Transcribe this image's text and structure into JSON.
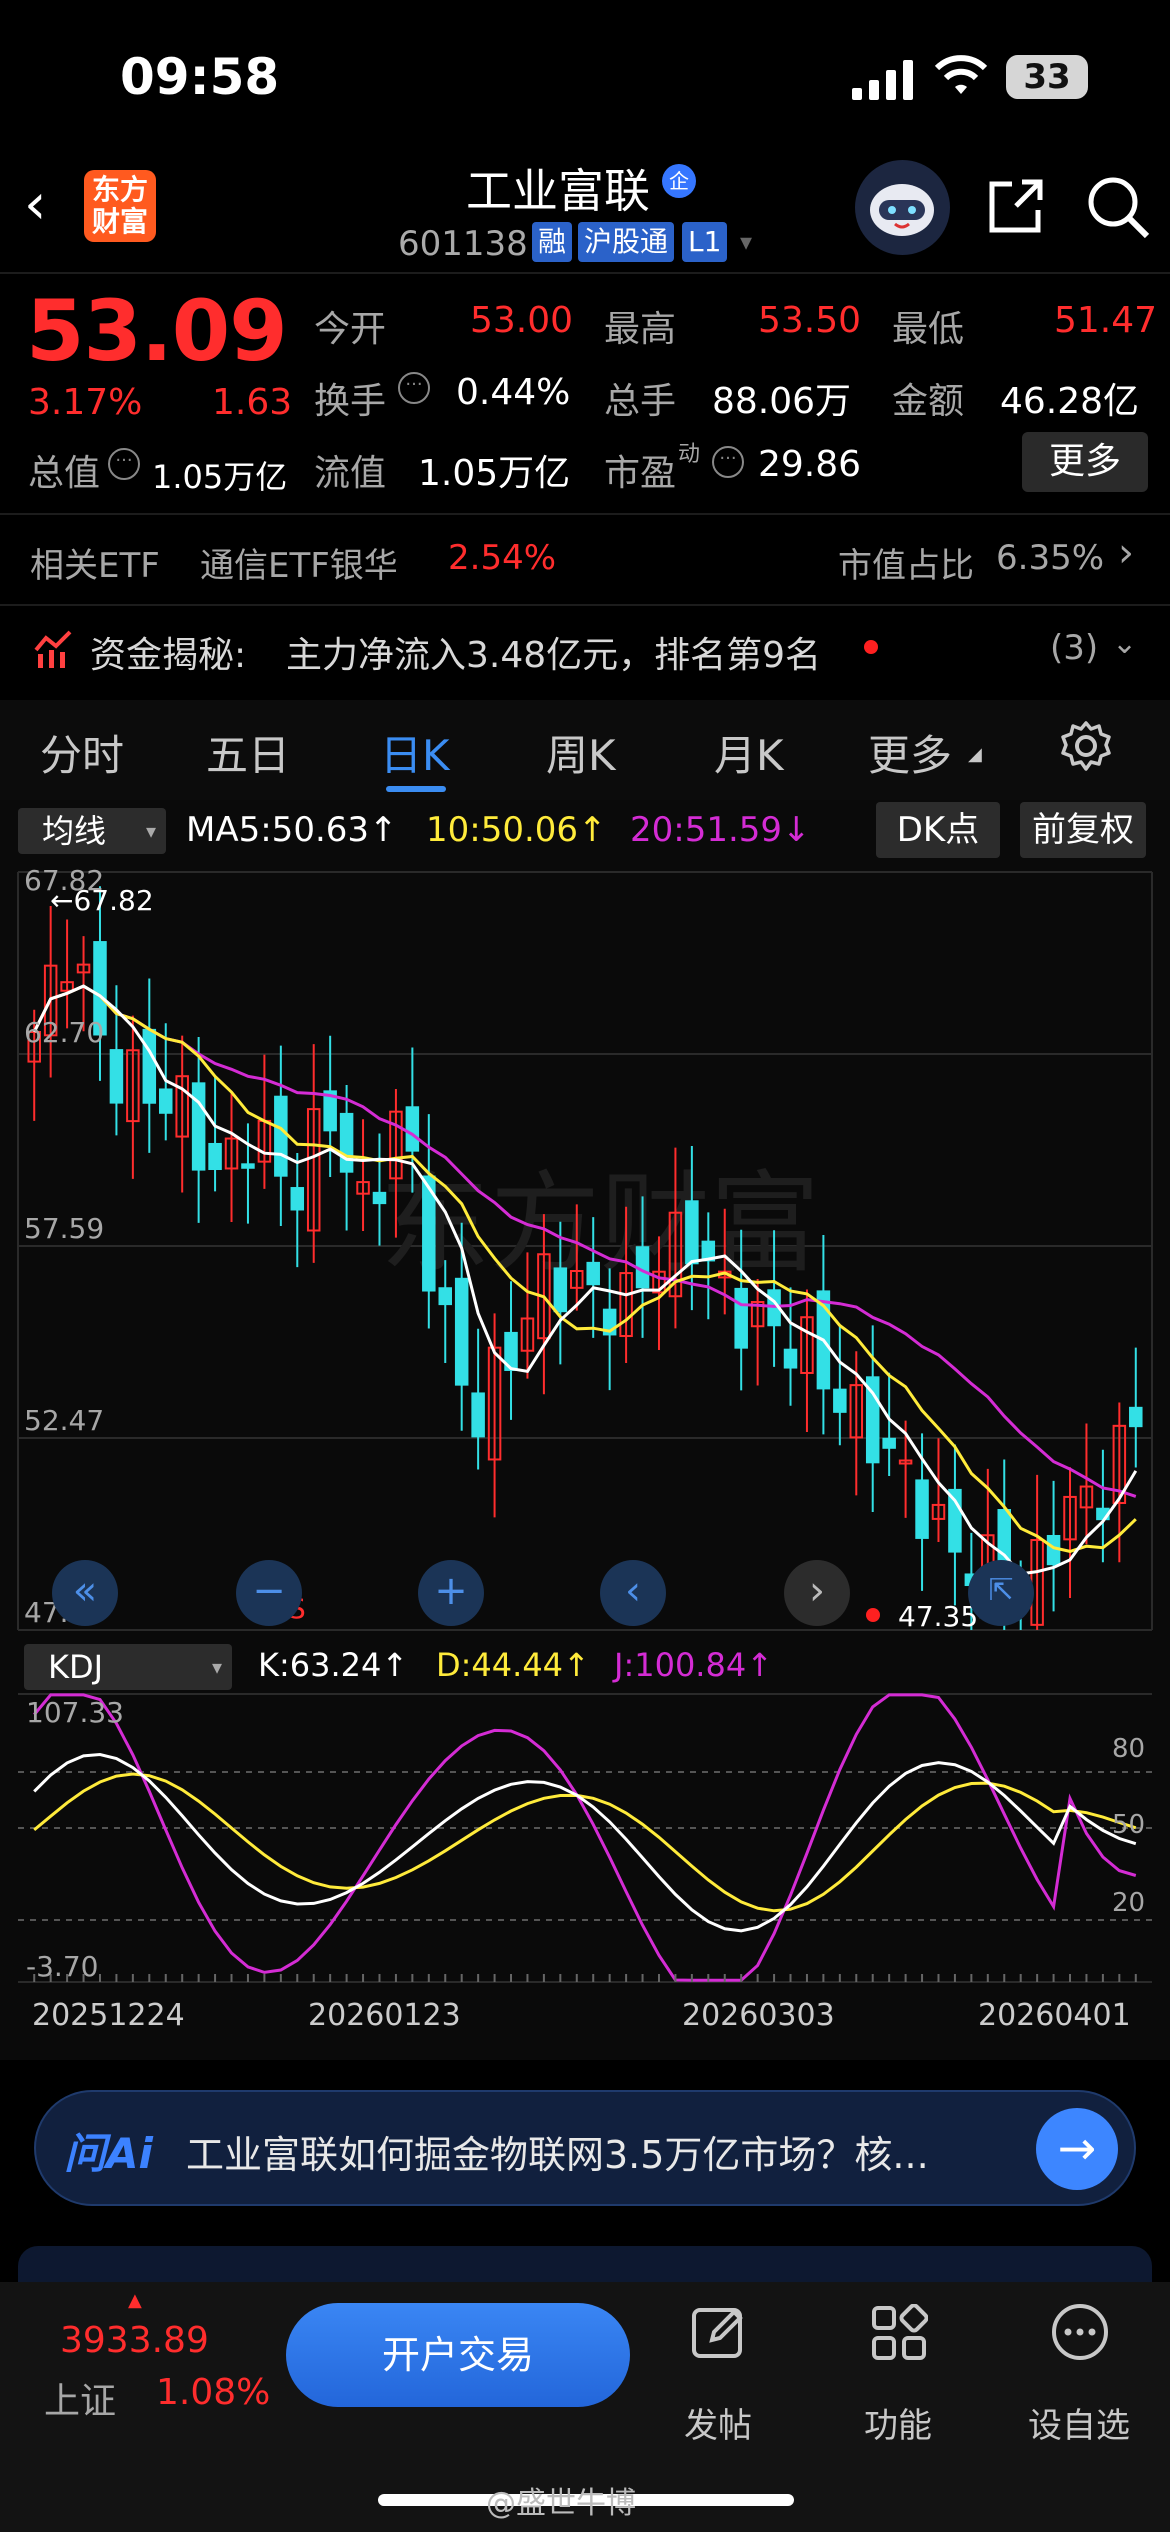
{
  "status_bar": {
    "time": "09:58",
    "battery": "33"
  },
  "header": {
    "app_logo_text": "东方\n财富",
    "stock_name": "工业富联",
    "badge": "企",
    "code": "601138",
    "tags": [
      "融",
      "沪股通",
      "L1"
    ]
  },
  "quote": {
    "price": "53.09",
    "change_pct": "3.17%",
    "change_amt": "1.63",
    "market_value_label": "总值",
    "market_value": "1.05万亿",
    "fields": [
      {
        "label": "今开",
        "value": "53.00",
        "color": "red"
      },
      {
        "label": "最高",
        "value": "53.50",
        "color": "red"
      },
      {
        "label": "最低",
        "value": "51.47",
        "color": "red"
      },
      {
        "label": "换手",
        "value": "0.44%",
        "color": "white"
      },
      {
        "label": "总手",
        "value": "88.06万",
        "color": "white"
      },
      {
        "label": "金额",
        "value": "46.28亿",
        "color": "white"
      },
      {
        "label": "流值",
        "value": "1.05万亿",
        "color": "white"
      },
      {
        "label": "市盈",
        "superscript": "动",
        "value": "29.86",
        "color": "white"
      }
    ],
    "more": "更多"
  },
  "etf": {
    "label": "相关ETF",
    "name": "通信ETF银华",
    "change": "2.54%",
    "ratio_label": "市值占比",
    "ratio": "6.35%"
  },
  "fund_flow": {
    "label": "资金揭秘:",
    "text": "主力净流入3.48亿元，排名第9名",
    "count": "(3)"
  },
  "tabs": [
    "分时",
    "五日",
    "日K",
    "周K",
    "月K",
    "更多"
  ],
  "active_tab": "日K",
  "kline": {
    "indicator_select": "均线",
    "ma5": "MA5:50.63",
    "ma10": "10:50.06",
    "ma20": "20:51.59",
    "dk_button": "DK点",
    "adjust_button": "前复权",
    "y_labels": [
      "67.82",
      "62.70",
      "57.59",
      "52.47",
      "47.35"
    ],
    "high_marker": "67.82",
    "low_marker": "47.35",
    "s_marker": "S"
  },
  "kdj": {
    "select": "KDJ",
    "k": "K:63.24",
    "d": "D:44.44",
    "j": "J:100.84",
    "y_top": "107.33",
    "y_bottom": "-3.70",
    "levels": [
      "80",
      "50",
      "20"
    ],
    "dates": [
      "20251224",
      "20260123",
      "20260303",
      "20260401"
    ]
  },
  "ai": {
    "logo": "问Ai",
    "question": "工业富联如何掘金物联网3.5万亿市场？核..."
  },
  "bottom_bar": {
    "index_value": "3933.89",
    "index_name": "上证",
    "index_change": "1.08%",
    "trade_button": "开户交易",
    "nav": [
      "发帖",
      "功能",
      "设自选"
    ]
  },
  "watermark": "@盛世牛博",
  "colors": {
    "up": "#ff2d2d",
    "down": "#33e0e6",
    "accent": "#3b8df2",
    "ma5": "#ffffff",
    "ma10": "#ffeb3b",
    "ma20": "#d42cd4"
  }
}
